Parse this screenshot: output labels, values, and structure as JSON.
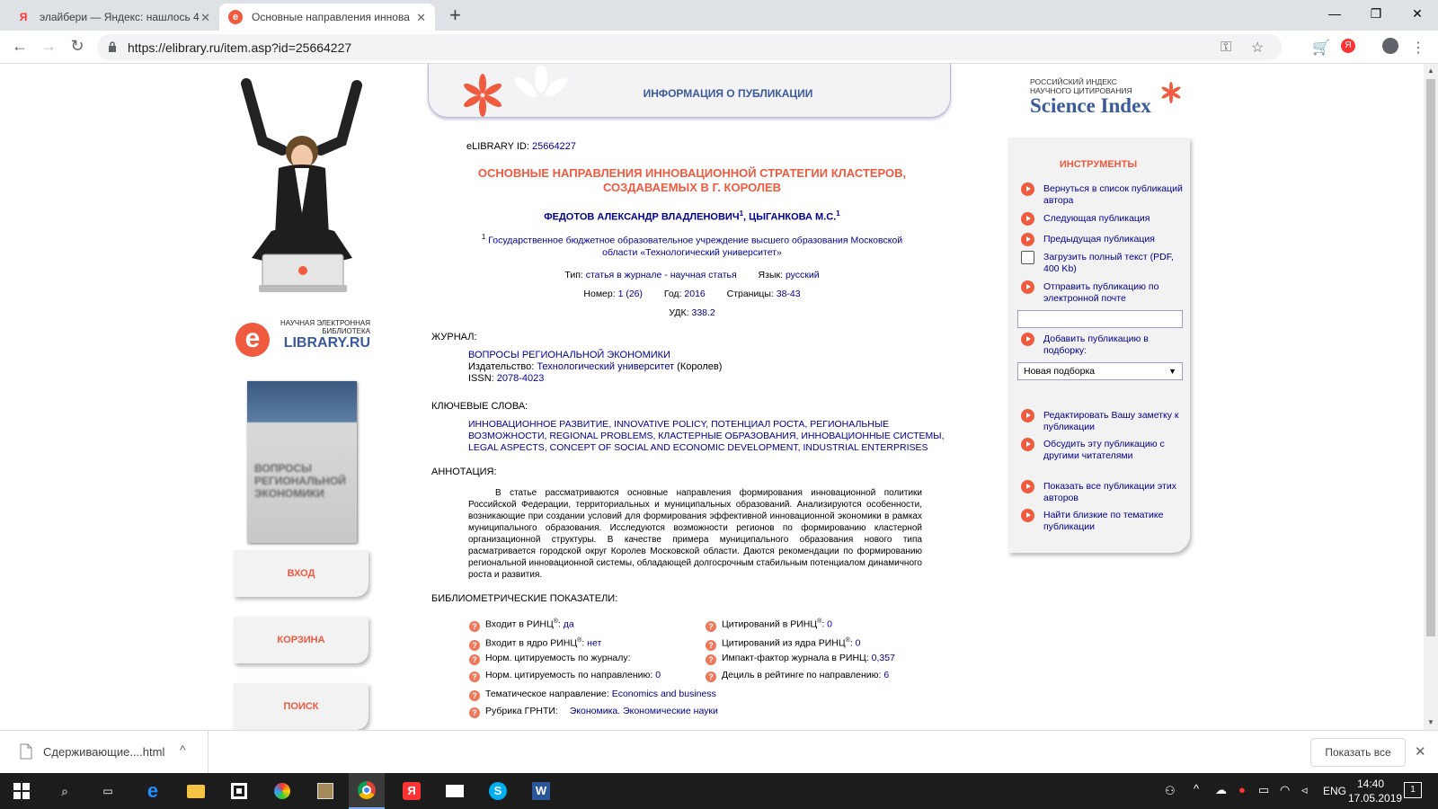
{
  "browser": {
    "tabs": [
      {
        "title": "элайбери — Яндекс: нашлось 4",
        "favicon": "Я"
      },
      {
        "title": "Основные направления иннова",
        "favicon": "e"
      }
    ],
    "url": "https://elibrary.ru/item.asp?id=25664227"
  },
  "left": {
    "logo_caption": "НАУЧНАЯ ЭЛЕКТРОННАЯ БИБЛИОТЕКА",
    "logo_brand": "LIBRARY.RU",
    "cover_text": "ВОПРОСЫ РЕГИОНАЛЬНОЙ ЭКОНОМИКИ",
    "nav": [
      "ВХОД",
      "КОРЗИНА",
      "ПОИСК"
    ]
  },
  "header": {
    "title": "ИНФОРМАЦИЯ О ПУБЛИКАЦИИ"
  },
  "publication": {
    "id_label": "eLIBRARY ID:",
    "id_value": "25664227",
    "title_line1": "ОСНОВНЫЕ НАПРАВЛЕНИЯ ИННОВАЦИОННОЙ СТРАТЕГИИ КЛАСТЕРОВ,",
    "title_line2": "СОЗДАВАЕМЫХ В Г. КОРОЛЕВ",
    "author1": "ФЕДОТОВ АЛЕКСАНДР ВЛАДЛЕНОВИЧ",
    "author2": "ЦЫГАНКОВА М.С.",
    "sup": "1",
    "affiliation_line1": "Государственное бюджетное образовательное учреждение высшего образования Московской",
    "affiliation_line2": "области «Технологический университет»",
    "type_label": "Тип:",
    "type_value": "статья в журнале - научная статья",
    "lang_label": "Язык:",
    "lang_value": "русский",
    "number_label": "Номер:",
    "number_value": "1 (26)",
    "year_label": "Год:",
    "year_value": "2016",
    "pages_label": "Страницы:",
    "pages_value": "38-43",
    "udk_label": "УДК:",
    "udk_value": "338.2"
  },
  "journal": {
    "section": "ЖУРНАЛ:",
    "name": "ВОПРОСЫ РЕГИОНАЛЬНОЙ ЭКОНОМИКИ",
    "publisher_label": "Издательство:",
    "publisher": "Технологический университет",
    "publisher_city": "(Королев)",
    "issn_label": "ISSN:",
    "issn": "2078-4023"
  },
  "keywords": {
    "section": "КЛЮЧЕВЫЕ СЛОВА:",
    "line1": "ИННОВАЦИОННОЕ РАЗВИТИЕ, INNOVATIVE POLICY, ПОТЕНЦИАЛ РОСТА, РЕГИОНАЛЬНЫЕ",
    "line2": "ВОЗМОЖНОСТИ, REGIONAL PROBLEMS, КЛАСТЕРНЫЕ ОБРАЗОВАНИЯ, ИННОВАЦИОННЫЕ СИСТЕМЫ,",
    "line3": "LEGAL ASPECTS, CONCEPT OF SOCIAL AND ECONOMIC DEVELOPMENT, INDUSTRIAL ENTERPRISES"
  },
  "annotation": {
    "section": "АННОТАЦИЯ:",
    "text": "В статье рассматриваются основные направления формирования инновационной политики Российской Федерации, территориальных и муниципальных образований. Анализируются особенности, возникающие при создании условий для формирования эффективной инновационной экономики в рамках муниципального образования. Исследуются возможности регионов по формированию кластерной организационной структуры. В качестве примера муниципального образования нового типа расматривается городской округ Королев Московской области. Даются рекомендации по формированию региональной инновационной системы, обладающей долгосрочным стабильным потенциалом динамичного роста и развития."
  },
  "biblio": {
    "section": "БИБЛИОМЕТРИЧЕСКИЕ ПОКАЗАТЕЛИ:",
    "rinc_in_label": "Входит в РИНЦ",
    "rinc_in_value": "да",
    "core_in_label": "Входит в ядро РИНЦ",
    "core_in_value": "нет",
    "norm_journal_label": "Норм. цитируемость по журналу:",
    "norm_dir_label": "Норм. цитируемость по направлению:",
    "norm_dir_value": "0",
    "topic_label": "Тематическое направление:",
    "topic_value": "Economics and business",
    "grnti_label": "Рубрика ГРНТИ:",
    "grnti_value": "Экономика. Экономические науки",
    "cit_rinc_label": "Цитирований в РИНЦ",
    "cit_rinc_value": "0",
    "cit_core_label": "Цитирований из ядра РИНЦ",
    "cit_core_value": "0",
    "if_label": "Импакт-фактор журнала в РИНЦ:",
    "if_value": "0,357",
    "decile_label": "Дециль в рейтинге по направлению:",
    "decile_value": "6",
    "reg": "®"
  },
  "science_index": {
    "line1": "РОССИЙСКИЙ ИНДЕКС",
    "line2": "НАУЧНОГО ЦИТИРОВАНИЯ",
    "brand": "Science Index"
  },
  "tools": {
    "title": "ИНСТРУМЕНТЫ",
    "back": "Вернуться в список публикаций автора",
    "next": "Следующая публикация",
    "prev": "Предыдущая публикация",
    "download": "Загрузить полный текст (PDF, 400 Kb)",
    "email": "Отправить публикацию по электронной почте",
    "email_value": "",
    "add": "Добавить публикацию в подборку:",
    "collection_selected": "Новая подборка",
    "note": "Редактировать Вашу заметку к публикации",
    "discuss": "Обсудить эту публикацию с другими читателями",
    "show_all": "Показать все публикации этих авторов",
    "similar": "Найти близкие по тематике публикации"
  },
  "downloads": {
    "file": "Сдерживающие....html",
    "show_all": "Показать все"
  },
  "taskbar": {
    "lang": "ENG",
    "time": "14:40",
    "date": "17.05.2019",
    "notif_count": "1"
  },
  "colors": {
    "accent": "#f05a3f",
    "link": "#00008f",
    "header_text": "#3a5a9b"
  }
}
